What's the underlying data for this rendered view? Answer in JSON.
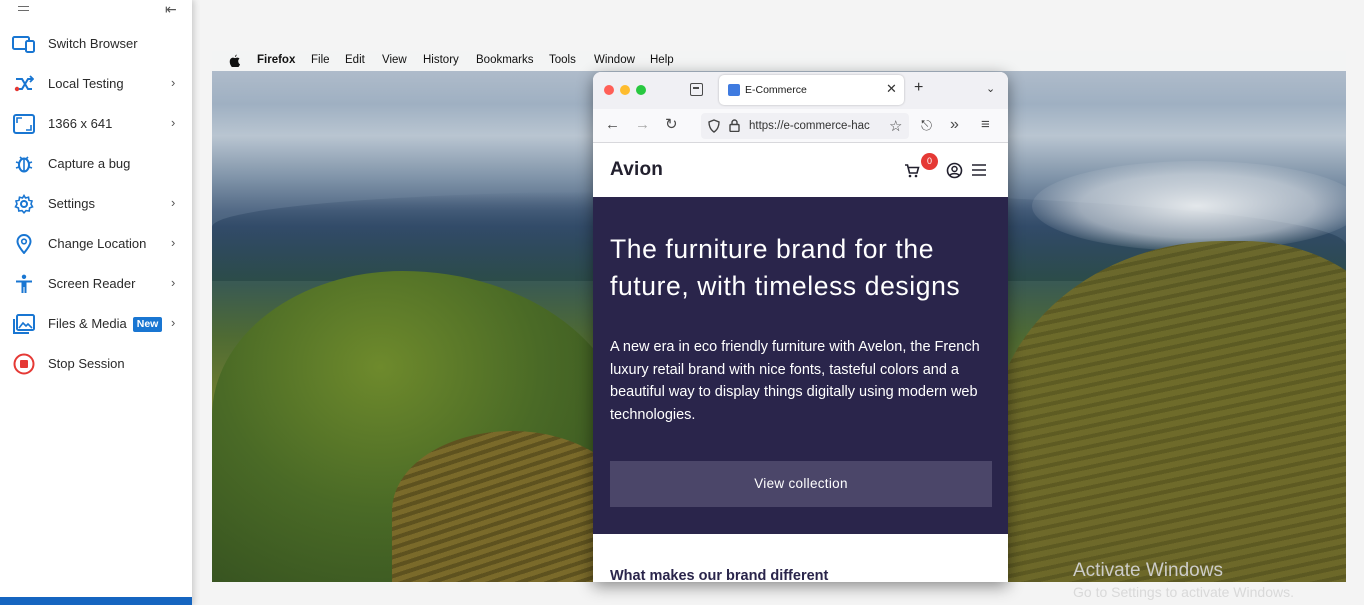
{
  "sidebar": {
    "items": [
      {
        "label": "Switch Browser",
        "icon": "switch-browser-icon",
        "has_submenu": false
      },
      {
        "label": "Local Testing",
        "icon": "local-testing-icon",
        "has_submenu": true
      },
      {
        "label": "1366 x 641",
        "icon": "resolution-icon",
        "has_submenu": true
      },
      {
        "label": "Capture a bug",
        "icon": "bug-icon",
        "has_submenu": false
      },
      {
        "label": "Settings",
        "icon": "gear-icon",
        "has_submenu": true
      },
      {
        "label": "Change Location",
        "icon": "location-pin-icon",
        "has_submenu": true
      },
      {
        "label": "Screen Reader",
        "icon": "accessibility-icon",
        "has_submenu": true
      },
      {
        "label": "Files & Media",
        "icon": "image-icon",
        "has_submenu": true,
        "badge": "New"
      },
      {
        "label": "Stop Session",
        "icon": "stop-icon",
        "has_submenu": false
      }
    ],
    "accent_color": "#1976d2",
    "stop_color": "#e53935"
  },
  "mac_menubar": {
    "app": "Firefox",
    "items": [
      "File",
      "Edit",
      "View",
      "History",
      "Bookmarks",
      "Tools",
      "Window",
      "Help"
    ]
  },
  "browser": {
    "tab_title": "E-Commerce",
    "url": "https://e-commerce-hac",
    "new_tab": "+"
  },
  "site": {
    "logo": "Avion",
    "cart_count": "0",
    "hero_title": "The furniture brand for the future, with timeless designs",
    "hero_body": "A new era in eco friendly furniture with Avelon, the French luxury retail brand with nice fonts, tasteful colors and a beautiful way to display things digitally using modern web technologies.",
    "cta": "View collection",
    "section_title": "What makes our brand different",
    "hero_bg": "#2a254b",
    "cta_bg": "#4b4669"
  },
  "watermark": {
    "line1": "Activate Windows",
    "line2": "Go to Settings to activate Windows."
  }
}
